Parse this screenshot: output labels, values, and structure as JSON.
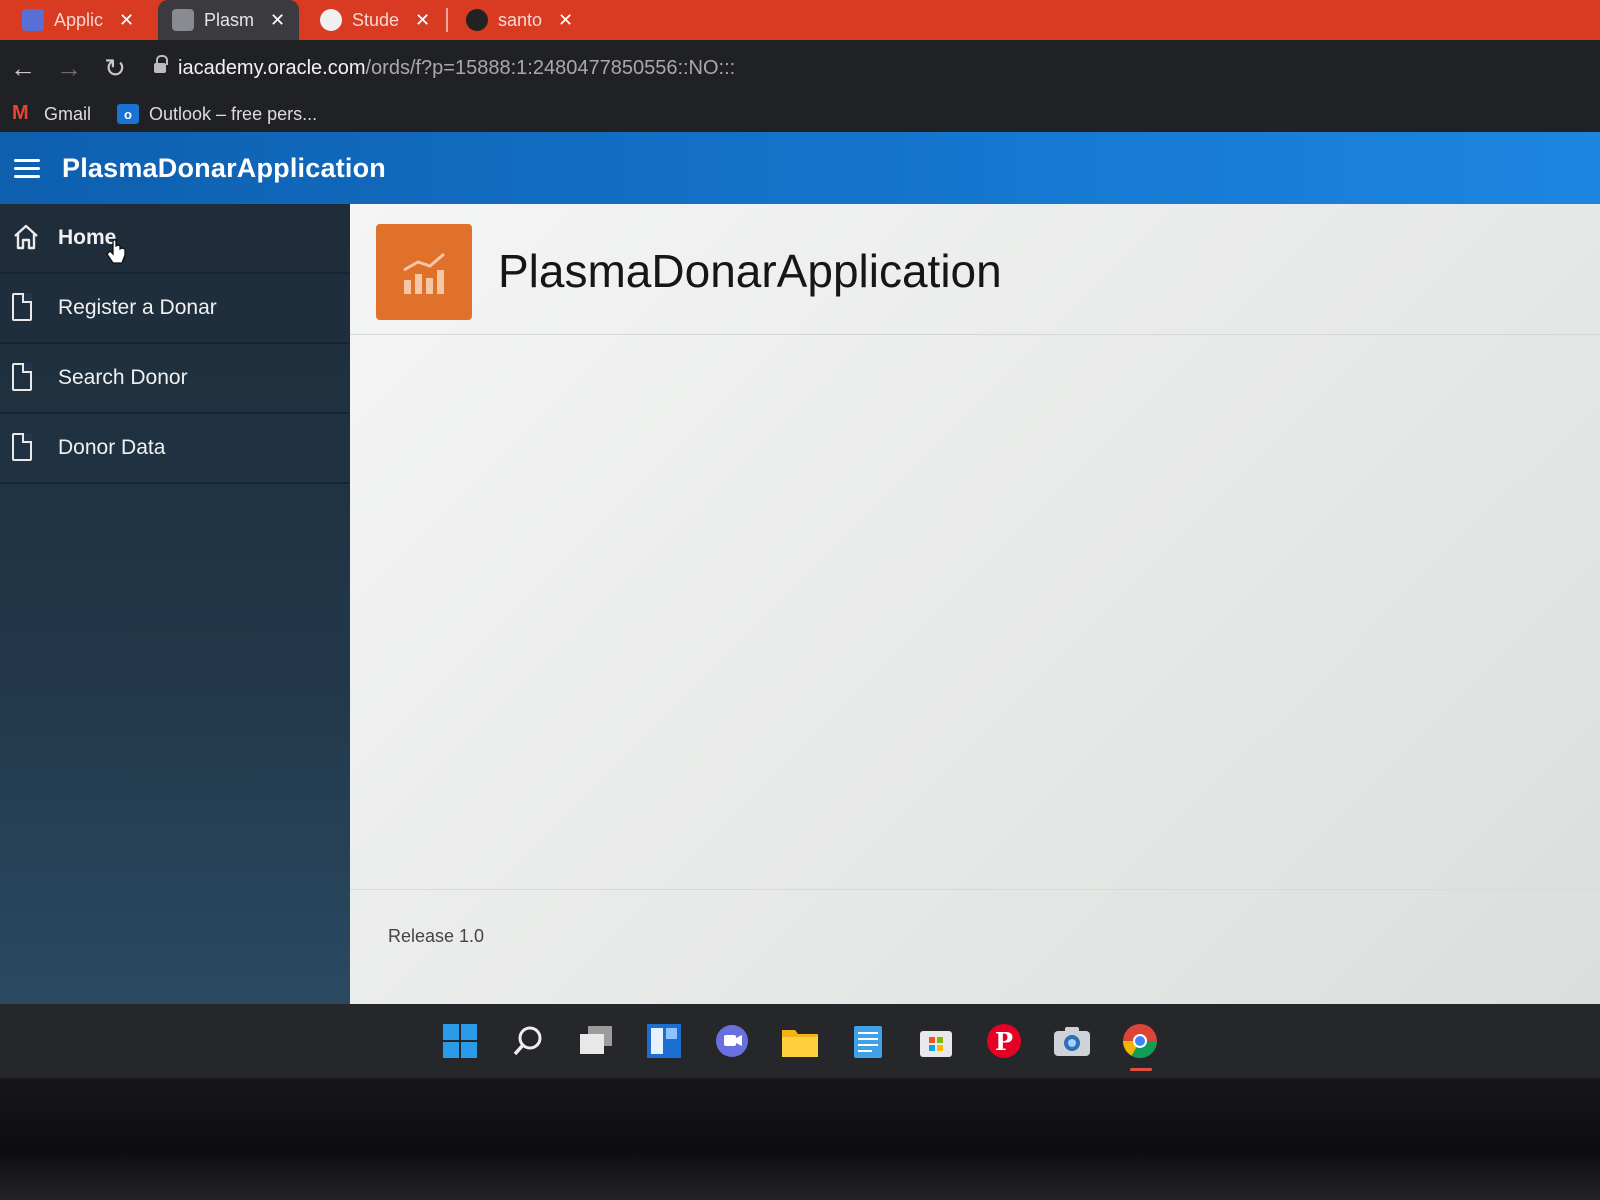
{
  "browser": {
    "tabs": [
      {
        "label": "Applic",
        "active": false
      },
      {
        "label": "Plasm",
        "active": true
      },
      {
        "label": "Stude",
        "active": false
      },
      {
        "label": "santo",
        "active": false
      }
    ],
    "url_host": "iacademy.oracle.com",
    "url_path": "/ords/f?p=15888:1:2480477850556::NO:::",
    "bookmarks": [
      {
        "label": "Gmail",
        "icon": "gmail-icon"
      },
      {
        "label": "Outlook – free pers...",
        "icon": "outlook-icon"
      }
    ]
  },
  "app": {
    "header_title": "PlasmaDonarApplication",
    "nav": [
      {
        "label": "Home",
        "icon": "home-icon",
        "active": true
      },
      {
        "label": "Register a Donar",
        "icon": "document-icon",
        "active": false
      },
      {
        "label": "Search Donor",
        "icon": "document-icon",
        "active": false
      },
      {
        "label": "Donor Data",
        "icon": "document-icon",
        "active": false
      }
    ],
    "page_title": "PlasmaDonarApplication",
    "release": "Release 1.0",
    "accent_color": "#e0712a",
    "header_color": "#1576cf"
  },
  "taskbar": {
    "icons": [
      "windows-start-icon",
      "search-icon",
      "task-view-icon",
      "widgets-icon",
      "teams-chat-icon",
      "file-explorer-icon",
      "notepad-icon",
      "microsoft-store-icon",
      "pinterest-icon",
      "camera-icon",
      "chrome-icon"
    ]
  }
}
